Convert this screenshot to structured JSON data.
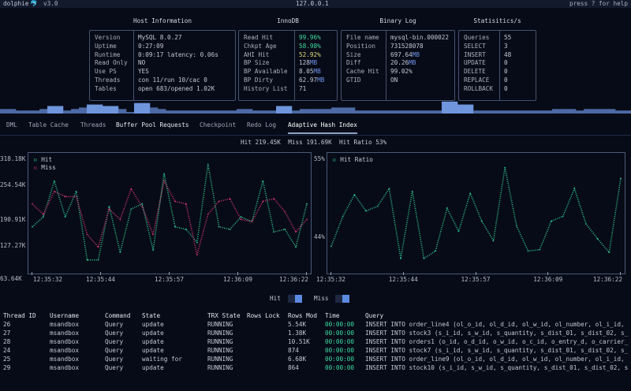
{
  "header": {
    "app": "dolphie",
    "logo_icon": "dolphin-icon",
    "version": "v3.0",
    "host": "127.0.0.1",
    "help": "press ? for help"
  },
  "host_info": {
    "title": "Host Information",
    "rows": [
      {
        "label": "Version",
        "value": "MySQL 8.0.27"
      },
      {
        "label": "Uptime",
        "value": "0:27:09"
      },
      {
        "label": "Runtime",
        "value": "0:09:17 latency: 0.06s"
      },
      {
        "label": "Read Only",
        "value": "NO"
      },
      {
        "label": "Use PS",
        "value": "YES"
      },
      {
        "label": "Threads",
        "value": "con 11/run 10/cac 0"
      },
      {
        "label": "Tables",
        "value": "open 683/opened 1.02K"
      }
    ]
  },
  "innodb": {
    "title": "InnoDB",
    "rows": [
      {
        "label": "Read Hit",
        "value": "99.96%",
        "color": "green"
      },
      {
        "label": "Chkpt Age",
        "value": "58.98%",
        "color": "green"
      },
      {
        "label": "AHI Hit",
        "value": "52.92%",
        "color": "yellow"
      },
      {
        "label": "BP Size",
        "value": "128",
        "unit": "MB"
      },
      {
        "label": "BP Available",
        "value": "8.05",
        "unit": "MB"
      },
      {
        "label": "BP Dirty",
        "value": "62.97",
        "unit": "MB"
      },
      {
        "label": "History List",
        "value": "71"
      }
    ]
  },
  "binlog": {
    "title": "Binary Log",
    "rows": [
      {
        "label": "File name",
        "value": "mysql-bin.000022"
      },
      {
        "label": "Position",
        "value": "731528078"
      },
      {
        "label": "Size",
        "value": "697.64",
        "unit": "MB"
      },
      {
        "label": "Diff",
        "value": "20.26",
        "unit": "MB"
      },
      {
        "label": "Cache Hit",
        "value": "99.02%"
      },
      {
        "label": "GTID",
        "value": "ON"
      }
    ]
  },
  "stats": {
    "title": "Statisitics/s",
    "rows": [
      {
        "label": "Queries",
        "value": "55"
      },
      {
        "label": "SELECT",
        "value": "3"
      },
      {
        "label": "INSERT",
        "value": "48"
      },
      {
        "label": "UPDATE",
        "value": "0"
      },
      {
        "label": "DELETE",
        "value": "0"
      },
      {
        "label": "REPLACE",
        "value": "0"
      },
      {
        "label": "ROLLBACK",
        "value": "0"
      }
    ]
  },
  "activity_bars": [
    3,
    3,
    2,
    2,
    2,
    3,
    5,
    5,
    2,
    3,
    4,
    6,
    6,
    5,
    5,
    3,
    1,
    7,
    7,
    4,
    3,
    2,
    2,
    2,
    2,
    2,
    2,
    2,
    2,
    2,
    3,
    3,
    2,
    2,
    2,
    5,
    5,
    2,
    3,
    3,
    3,
    3,
    4,
    4,
    4,
    2,
    2,
    2,
    2,
    2,
    2,
    2,
    2,
    2,
    2,
    2,
    8,
    8,
    6,
    6,
    2,
    2,
    2,
    2,
    2,
    2,
    2,
    2,
    2,
    2,
    3,
    3,
    3,
    2,
    3,
    3,
    3,
    3,
    2,
    2
  ],
  "tabs": [
    {
      "label": "DML"
    },
    {
      "label": "Table Cache"
    },
    {
      "label": "Threads"
    },
    {
      "label": "Buffer Pool Requests",
      "bold": true
    },
    {
      "label": "Checkpoint"
    },
    {
      "label": "Redo Log"
    },
    {
      "label": "Adaptive Hash Index",
      "active": true
    }
  ],
  "summary": {
    "hit": "Hit 219.45K",
    "miss": "Miss 191.69K",
    "ratio": "Hit Ratio 53%"
  },
  "chart_data": [
    {
      "type": "line",
      "x_ticks": [
        "12:35:32",
        "12:35:44",
        "12:35:57",
        "12:36:09",
        "12:36:22"
      ],
      "y_ticks": [
        "63.64K",
        "127.27K",
        "190.91K",
        "254.54K",
        "318.18K"
      ],
      "ylim": [
        63.64,
        318.18
      ],
      "legend": "top-left",
      "x": [
        "12:35:32",
        "12:35:34",
        "12:35:36",
        "12:35:38",
        "12:35:40",
        "12:35:42",
        "12:35:44",
        "12:35:46",
        "12:35:48",
        "12:35:50",
        "12:35:52",
        "12:35:54",
        "12:35:56",
        "12:35:58",
        "12:36:00",
        "12:36:02",
        "12:36:04",
        "12:36:06",
        "12:36:08",
        "12:36:10",
        "12:36:12",
        "12:36:14",
        "12:36:16",
        "12:36:18",
        "12:36:20",
        "12:36:22"
      ],
      "series": [
        {
          "name": "Hit",
          "color": "#2fc08f",
          "values": [
            165,
            188,
            271,
            188,
            247,
            88,
            88,
            212,
            106,
            206,
            218,
            111,
            288,
            165,
            159,
            129,
            310,
            165,
            159,
            188,
            177,
            271,
            153,
            159,
            118,
            218
          ]
        },
        {
          "name": "Miss",
          "color": "#c8366e",
          "values": [
            218,
            194,
            247,
            235,
            235,
            147,
            118,
            206,
            182,
            253,
            212,
            147,
            271,
            224,
            218,
            100,
            194,
            224,
            230,
            182,
            177,
            224,
            230,
            200,
            153,
            182
          ]
        }
      ]
    },
    {
      "type": "line",
      "x_ticks": [
        "12:35:32",
        "12:35:44",
        "12:35:57",
        "12:36:09",
        "12:36:22"
      ],
      "y_ticks": [
        "44%",
        "55%"
      ],
      "ylim": [
        40,
        55
      ],
      "legend": "top-left",
      "x": [
        "12:35:32",
        "12:35:34",
        "12:35:36",
        "12:35:38",
        "12:35:40",
        "12:35:42",
        "12:35:44",
        "12:35:46",
        "12:35:48",
        "12:35:50",
        "12:35:52",
        "12:35:54",
        "12:35:56",
        "12:35:58",
        "12:36:00",
        "12:36:02",
        "12:36:04",
        "12:36:06",
        "12:36:08",
        "12:36:10",
        "12:36:12",
        "12:36:14",
        "12:36:16",
        "12:36:18",
        "12:36:20",
        "12:36:22"
      ],
      "series": [
        {
          "name": "Hit Ratio",
          "color": "#2fc08f",
          "values": [
            42.4,
            46.8,
            50.0,
            47.6,
            48.3,
            50.9,
            40.6,
            50.5,
            40.6,
            41.7,
            48.0,
            44.6,
            50.2,
            46.1,
            43.2,
            54.0,
            45.4,
            41.7,
            41.9,
            46.1,
            46.8,
            50.9,
            45.7,
            43.5,
            41.5,
            52.4
          ]
        }
      ]
    }
  ],
  "toggles": {
    "hit": "Hit",
    "miss": "Miss"
  },
  "table": {
    "headers": [
      "Thread ID",
      "Username",
      "Command",
      "State",
      "TRX State",
      "Rows Lock",
      "Rows Mod",
      "Time",
      "Query"
    ],
    "rows": [
      [
        "26",
        "msandbox",
        "Query",
        "update",
        "RUNNING",
        "",
        "5.54K",
        "00:00:00",
        "INSERT INTO order_line4 (ol_o_id, ol_d_id, ol_w_id, ol_number, ol_i_id, "
      ],
      [
        "27",
        "msandbox",
        "Query",
        "update",
        "RUNNING",
        "",
        "1.38K",
        "00:00:00",
        "INSERT INTO stock3 (s_i_id, s_w_id, s_quantity, s_dist_01, s_dist_02, s_"
      ],
      [
        "28",
        "msandbox",
        "Query",
        "update",
        "RUNNING",
        "",
        "10.51K",
        "00:00:00",
        "INSERT INTO orders1 (o_id, o_d_id, o_w_id, o_c_id, o_entry_d, o_carrier_"
      ],
      [
        "24",
        "msandbox",
        "Query",
        "update",
        "RUNNING",
        "",
        "874",
        "00:00:00",
        "INSERT INTO stock7 (s_i_id, s_w_id, s_quantity, s_dist_01, s_dist_02, s_"
      ],
      [
        "25",
        "msandbox",
        "Query",
        "waiting for",
        "RUNNING",
        "",
        "6.68K",
        "00:00:00",
        "INSERT INTO order_line9 (ol_o_id, ol_d_id, ol_w_id, ol_number, ol_i_id, "
      ],
      [
        "29",
        "msandbox",
        "Query",
        "update",
        "RUNNING",
        "",
        "864",
        "00:00:00",
        "INSERT INTO stock10 (s_i_id, s_w_id, s_quantity, s_dist_01, s_dist_02, s"
      ]
    ]
  }
}
